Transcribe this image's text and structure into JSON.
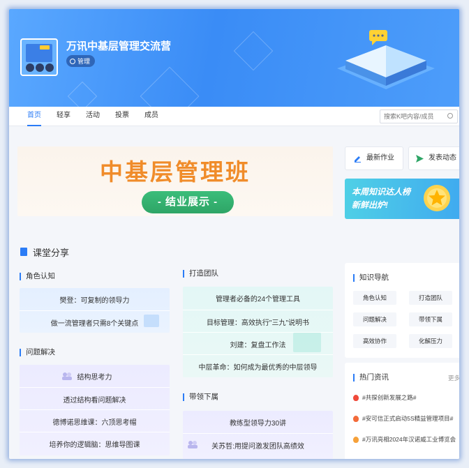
{
  "header": {
    "title": "万讯中基层管理交流营",
    "tag": "管理"
  },
  "nav": {
    "tabs": [
      "首页",
      "轻享",
      "活动",
      "投票",
      "成员"
    ],
    "active_index": 0,
    "search_placeholder": "搜索K吧内容/成员"
  },
  "hero": {
    "title": "中基层管理班",
    "button": "- 结业展示 -"
  },
  "quick_actions": {
    "latest_homework": "最新作业",
    "post_update": "发表动态"
  },
  "promo": {
    "text": "本周知识达人榜\n新鲜出炉!"
  },
  "section": {
    "title": "课堂分享"
  },
  "columns": {
    "role": {
      "heading": "角色认知",
      "items": [
        "樊登：可复制的领导力",
        "做一流管理者只需8个关键点"
      ]
    },
    "problem": {
      "heading": "问题解决",
      "items": [
        "结构思考力",
        "透过结构看问题解决",
        "德博诺思维课：六顶思考帽",
        "培养你的逻辑脑：思维导图课"
      ]
    },
    "team": {
      "heading": "打造团队",
      "items": [
        "管理者必备的24个管理工具",
        "目标管理：高效执行\"三九\"说明书",
        "刘建：复盘工作法",
        "中层革命：如何成为最优秀的中层领导"
      ]
    },
    "lead": {
      "heading": "带领下属",
      "items": [
        "教练型领导力30讲",
        "关苏哲:用提问激发团队高绩效"
      ]
    }
  },
  "knowledge_nav": {
    "title": "知识导航",
    "chips": [
      "角色认知",
      "打造团队",
      "问题解决",
      "带领下属",
      "高效协作",
      "化解压力"
    ]
  },
  "hot_news": {
    "title": "热门资讯",
    "more": "更多",
    "items": [
      "#共探创新发展之路#",
      "#安可信正式启动5S精益管理项目#",
      "#万讯亮相2024年汉诺威工业博览会"
    ]
  },
  "colors": {
    "accent": "#2b7cf6",
    "hero_orange": "#f08c2a",
    "hero_green": "#2ea566"
  }
}
